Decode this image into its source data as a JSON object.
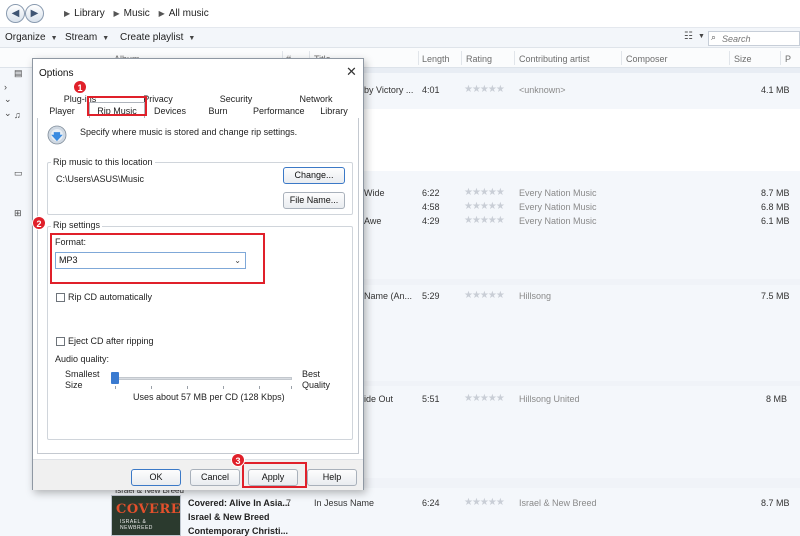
{
  "nav": {
    "back_icon": "back-arrow-icon",
    "forward_icon": "forward-arrow-icon",
    "breadcrumb": [
      "Library",
      "Music",
      "All music"
    ]
  },
  "toolbar": {
    "organize": "Organize",
    "stream": "Stream",
    "create_playlist": "Create playlist",
    "search_placeholder": "Search"
  },
  "columns": {
    "album": "Album",
    "number": "#",
    "title": "Title",
    "length": "Length",
    "rating": "Rating",
    "contributing_artist": "Contributing artist",
    "composer": "Composer",
    "size": "Size",
    "extra": "P"
  },
  "tracks": [
    {
      "title": "by Victory ...",
      "length": "4:01",
      "artist": "<unknown>",
      "size": "4.1 MB"
    },
    {
      "title": "Wide",
      "length": "6:22",
      "artist": "Every Nation Music",
      "size": "8.7 MB"
    },
    {
      "title": "",
      "length": "4:58",
      "artist": "Every Nation Music",
      "size": "6.8 MB"
    },
    {
      "title": "Awe",
      "length": "4:29",
      "artist": "Every Nation Music",
      "size": "6.1 MB"
    },
    {
      "title": "Name (An...",
      "length": "5:29",
      "artist": "Hillsong",
      "size": "7.5 MB"
    },
    {
      "title": "ide Out",
      "length": "5:51",
      "artist": "Hillsong United",
      "size": "8 MB"
    },
    {
      "title": "In Jesus Name",
      "number": "7",
      "length": "6:24",
      "artist": "Israel & New Breed",
      "size": "8.7 MB"
    }
  ],
  "album_info": {
    "caption": "Israel & New Breed",
    "album": "Covered: Alive In Asia...",
    "artist": "Israel & New Breed",
    "genre": "Contemporary Christi...",
    "art_title": "COVERED",
    "art_sub": "ISRAEL & NEWBREED"
  },
  "dialog": {
    "title": "Options",
    "tabs_row1": [
      "Plug-ins",
      "Privacy",
      "Security",
      "Network"
    ],
    "tabs_row2": [
      "Player",
      "Rip Music",
      "Devices",
      "Burn",
      "Performance",
      "Library"
    ],
    "description": "Specify where music is stored and change rip settings.",
    "location_group": "Rip music to this location",
    "location_path": "C:\\Users\\ASUS\\Music",
    "change_button": "Change...",
    "filename_button": "File Name...",
    "rip_settings_group": "Rip settings",
    "format_label": "Format:",
    "format_value": "MP3",
    "rip_cd_auto": "Rip CD automatically",
    "eject_cd": "Eject CD after ripping",
    "audio_quality_label": "Audio quality:",
    "smallest_size": "Smallest Size",
    "best_quality": "Best Quality",
    "uses_text": "Uses about 57 MB per CD (128 Kbps)",
    "quality_level": 0,
    "ok": "OK",
    "cancel": "Cancel",
    "apply": "Apply",
    "help": "Help"
  },
  "annotations": {
    "step1": "1",
    "step2": "2",
    "step3": "3",
    "color": "#e0202a"
  }
}
